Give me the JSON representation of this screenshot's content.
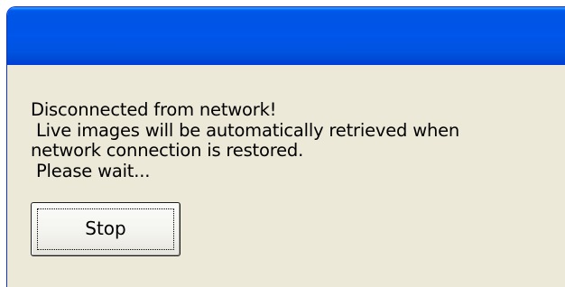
{
  "window": {
    "title": ""
  },
  "dialog": {
    "message_lines": [
      "Disconnected from network!",
      " Live images will be automatically retrieved when",
      "network connection is restored.",
      " Please wait..."
    ],
    "stop_label": "Stop"
  },
  "colors": {
    "titlebar": "#0055ea",
    "dialog_background": "#ece9d8",
    "text": "#000000"
  }
}
